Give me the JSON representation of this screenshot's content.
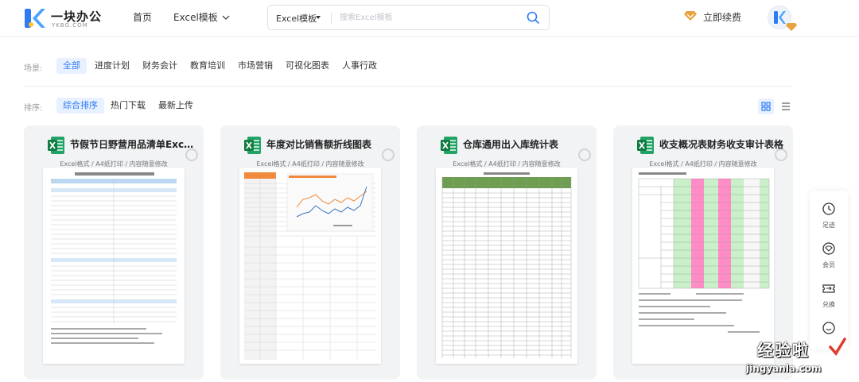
{
  "header": {
    "logo_name": "一块办公",
    "logo_sub": "YKBG.COM",
    "nav_home": "首页",
    "nav_templates": "Excel模板",
    "search_type": "Excel模板",
    "search_placeholder": "搜索Excel模板",
    "renew_label": "立即续费"
  },
  "filters": {
    "scene_label": "场景:",
    "scenes": [
      "全部",
      "进度计划",
      "财务会计",
      "教育培训",
      "市场营销",
      "可视化图表",
      "人事行政"
    ],
    "active_scene": "全部",
    "sort_label": "排序:",
    "sorts": [
      "综合排序",
      "热门下载",
      "最新上传"
    ],
    "active_sort": "综合排序"
  },
  "cards": [
    {
      "title": "节假节日野营用品清单Excel模板",
      "subtitle": "Excel格式 / A4纸打印 / 内容随意修改"
    },
    {
      "title": "年度对比销售额折线图表",
      "subtitle": "Excel格式 / A4纸打印 / 内容随意修改"
    },
    {
      "title": "仓库通用出入库统计表",
      "subtitle": "Excel格式 / A4纸打印 / 内容随意修改"
    },
    {
      "title": "收支概况表财务收支审计表格",
      "subtitle": "Excel格式 / A4纸打印 / 内容随意修改"
    }
  ],
  "float_toolbar": {
    "items": [
      {
        "label": "足迹",
        "icon": "clock-icon"
      },
      {
        "label": "会员",
        "icon": "diamond-icon"
      },
      {
        "label": "兑换",
        "icon": "ticket-icon"
      },
      {
        "label": "",
        "icon": "smile-icon"
      }
    ]
  },
  "watermark": {
    "text_cn": "经验啦",
    "text_url": "jingyanla.com"
  },
  "colors": {
    "accent": "#2f7bf5",
    "excel_green": "#1f9d55",
    "gold": "#e8a33d"
  }
}
